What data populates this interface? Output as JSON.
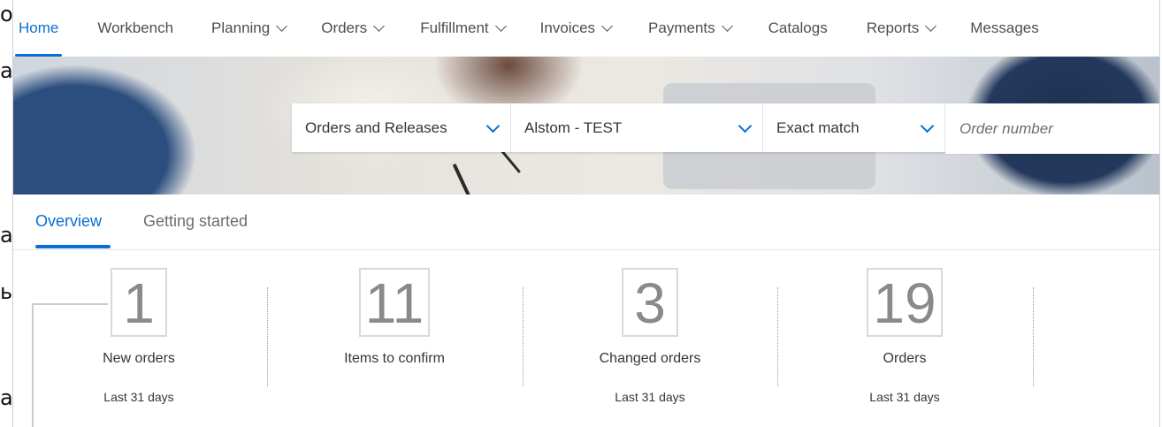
{
  "edge_fragments": [
    "о",
    "а",
    "а,",
    "ь",
    "а"
  ],
  "nav": {
    "items": [
      {
        "label": "Home",
        "has_dropdown": false,
        "active": true
      },
      {
        "label": "Workbench",
        "has_dropdown": false,
        "active": false
      },
      {
        "label": "Planning",
        "has_dropdown": true,
        "active": false
      },
      {
        "label": "Orders",
        "has_dropdown": true,
        "active": false
      },
      {
        "label": "Fulfillment",
        "has_dropdown": true,
        "active": false
      },
      {
        "label": "Invoices",
        "has_dropdown": true,
        "active": false
      },
      {
        "label": "Payments",
        "has_dropdown": true,
        "active": false
      },
      {
        "label": "Catalogs",
        "has_dropdown": false,
        "active": false
      },
      {
        "label": "Reports",
        "has_dropdown": true,
        "active": false
      },
      {
        "label": "Messages",
        "has_dropdown": false,
        "active": false
      }
    ]
  },
  "search": {
    "document_type": "Orders and Releases",
    "customer": "Alstom - TEST",
    "match_mode": "Exact match",
    "placeholder": "Order number",
    "value": ""
  },
  "tabs": {
    "overview": "Overview",
    "getting_started": "Getting started"
  },
  "tiles": [
    {
      "value": "1",
      "label": "New orders",
      "period": "Last 31 days"
    },
    {
      "value": "11",
      "label": "Items to confirm",
      "period": ""
    },
    {
      "value": "3",
      "label": "Changed orders",
      "period": "Last 31 days"
    },
    {
      "value": "19",
      "label": "Orders",
      "period": "Last 31 days"
    }
  ],
  "colors": {
    "accent": "#0a6ed1",
    "text": "#32363a",
    "muted": "#6a6d70"
  }
}
